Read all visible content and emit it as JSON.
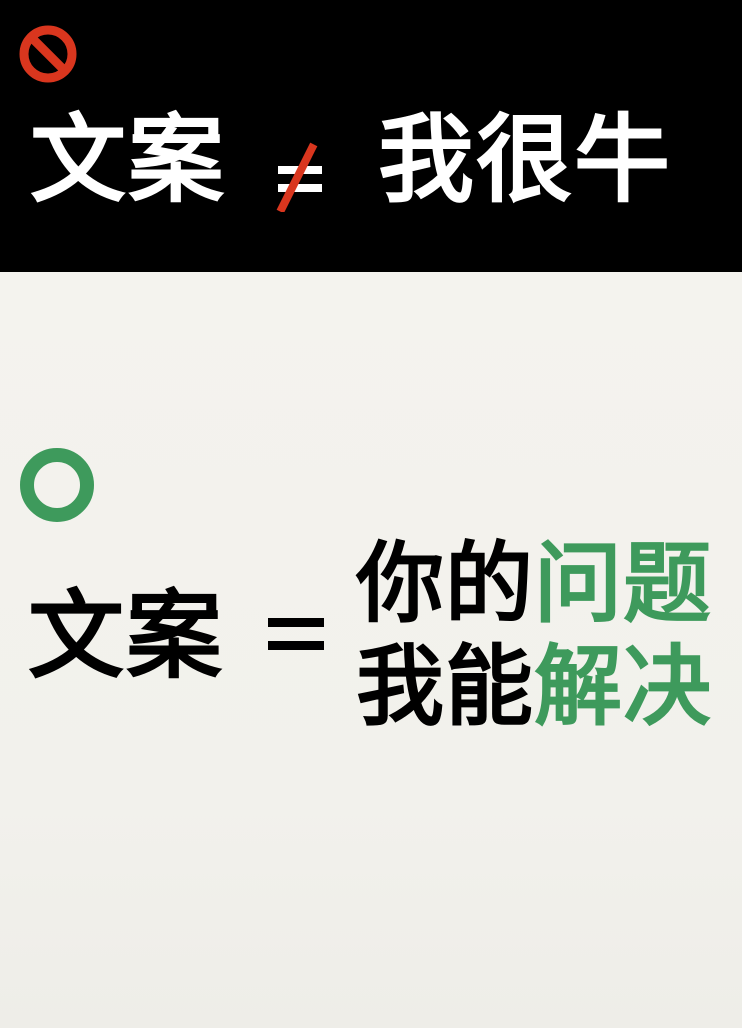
{
  "colors": {
    "top_background": "#000000",
    "bottom_background": "#f2f1ec",
    "no_icon": "#d9361e",
    "neq_slash": "#d9361e",
    "yes_icon": "#3e9a5c",
    "highlight": "#3e9a5c",
    "top_text": "#ffffff",
    "bottom_text": "#000000"
  },
  "icons": {
    "top": "no-entry-icon",
    "bottom": "circle-ok-icon"
  },
  "top": {
    "left_text": "文案",
    "right_text": "我很牛"
  },
  "bottom": {
    "left_text": "文案",
    "line1_black": "你的",
    "line1_green": "问题",
    "line2_black": "我能",
    "line2_green": "解决"
  }
}
